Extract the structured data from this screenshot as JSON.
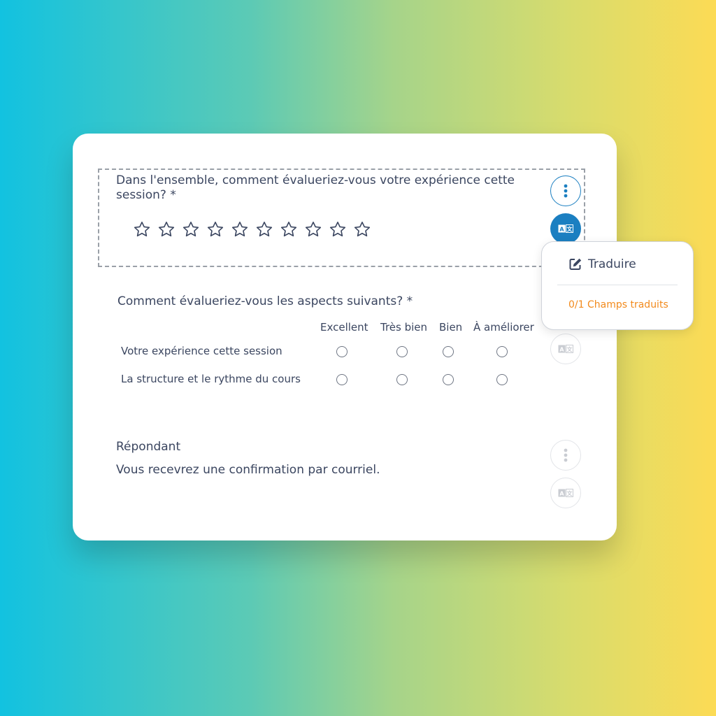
{
  "question1": {
    "title": "Dans l'ensemble, comment évalueriez-vous votre expérience cette session? *",
    "star_count": 10,
    "rating": 0
  },
  "question2": {
    "title": "Comment évalueriez-vous les aspects suivants? *",
    "columns": [
      "Excellent",
      "Très bien",
      "Bien",
      "À améliorer"
    ],
    "rows": [
      "Votre expérience cette session",
      "La structure et le rythme du cours"
    ]
  },
  "question3": {
    "title": "Répondant",
    "text": "Vous recevrez une confirmation par courriel."
  },
  "popover": {
    "action_label": "Traduire",
    "status": "0/1 Champs traduits"
  },
  "icons": {
    "menu": "more-vertical-icon",
    "translate": "translate-icon",
    "edit": "edit-icon",
    "star": "star-outline-icon"
  },
  "colors": {
    "accent": "#1b7fc1",
    "status": "#f28a1c",
    "text": "#3b4660"
  }
}
